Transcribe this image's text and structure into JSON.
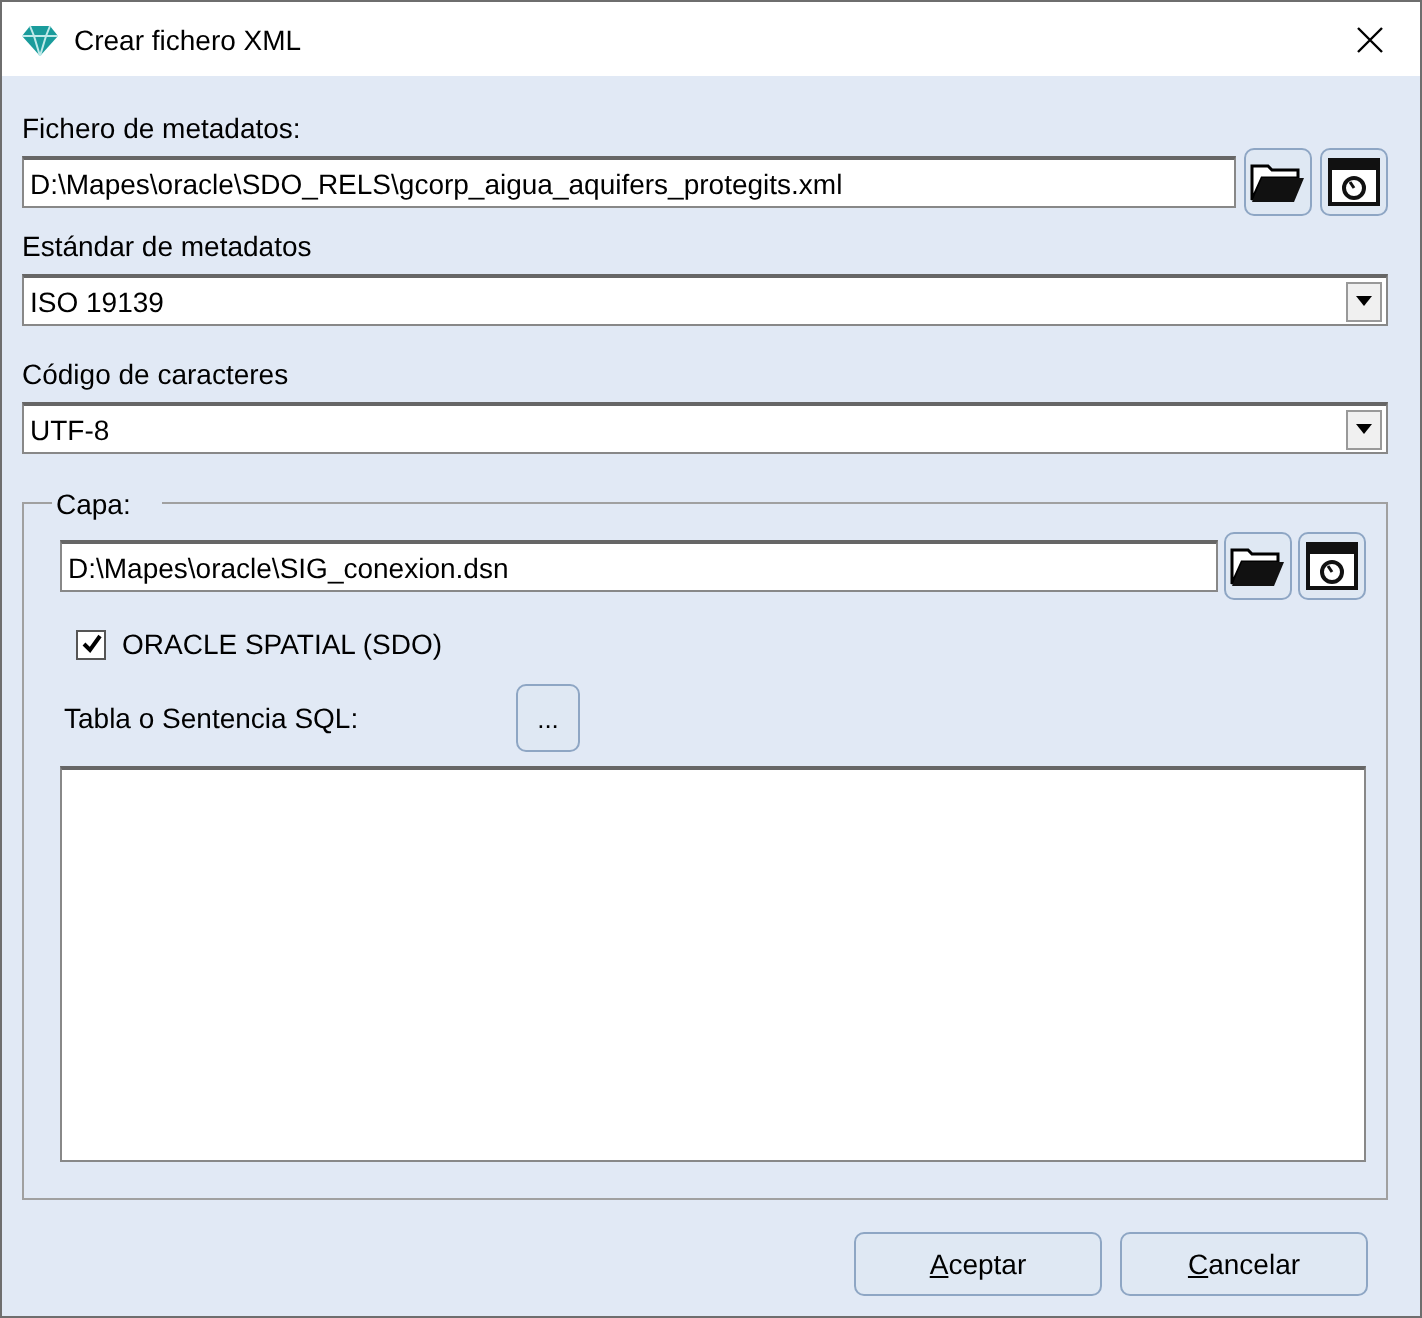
{
  "window": {
    "title": "Crear fichero XML"
  },
  "metadata_file": {
    "label": "Fichero de metadatos:",
    "value": "D:\\Mapes\\oracle\\SDO_RELS\\gcorp_aigua_aquifers_protegits.xml"
  },
  "standard": {
    "label": "Estándar de metadatos",
    "value": "ISO 19139"
  },
  "encoding": {
    "label": "Código de caracteres",
    "value": "UTF-8"
  },
  "layer": {
    "legend": "Capa:",
    "value": "D:\\Mapes\\oracle\\SIG_conexion.dsn",
    "oracle_spatial": {
      "label": "ORACLE SPATIAL (SDO)",
      "checked": true
    },
    "sql_label": "Tabla o Sentencia SQL:",
    "sql_button": "..."
  },
  "buttons": [
    {
      "label": "Aceptar",
      "mnemonic": true
    },
    {
      "label": "Cancelar",
      "mnemonic": true
    }
  ]
}
